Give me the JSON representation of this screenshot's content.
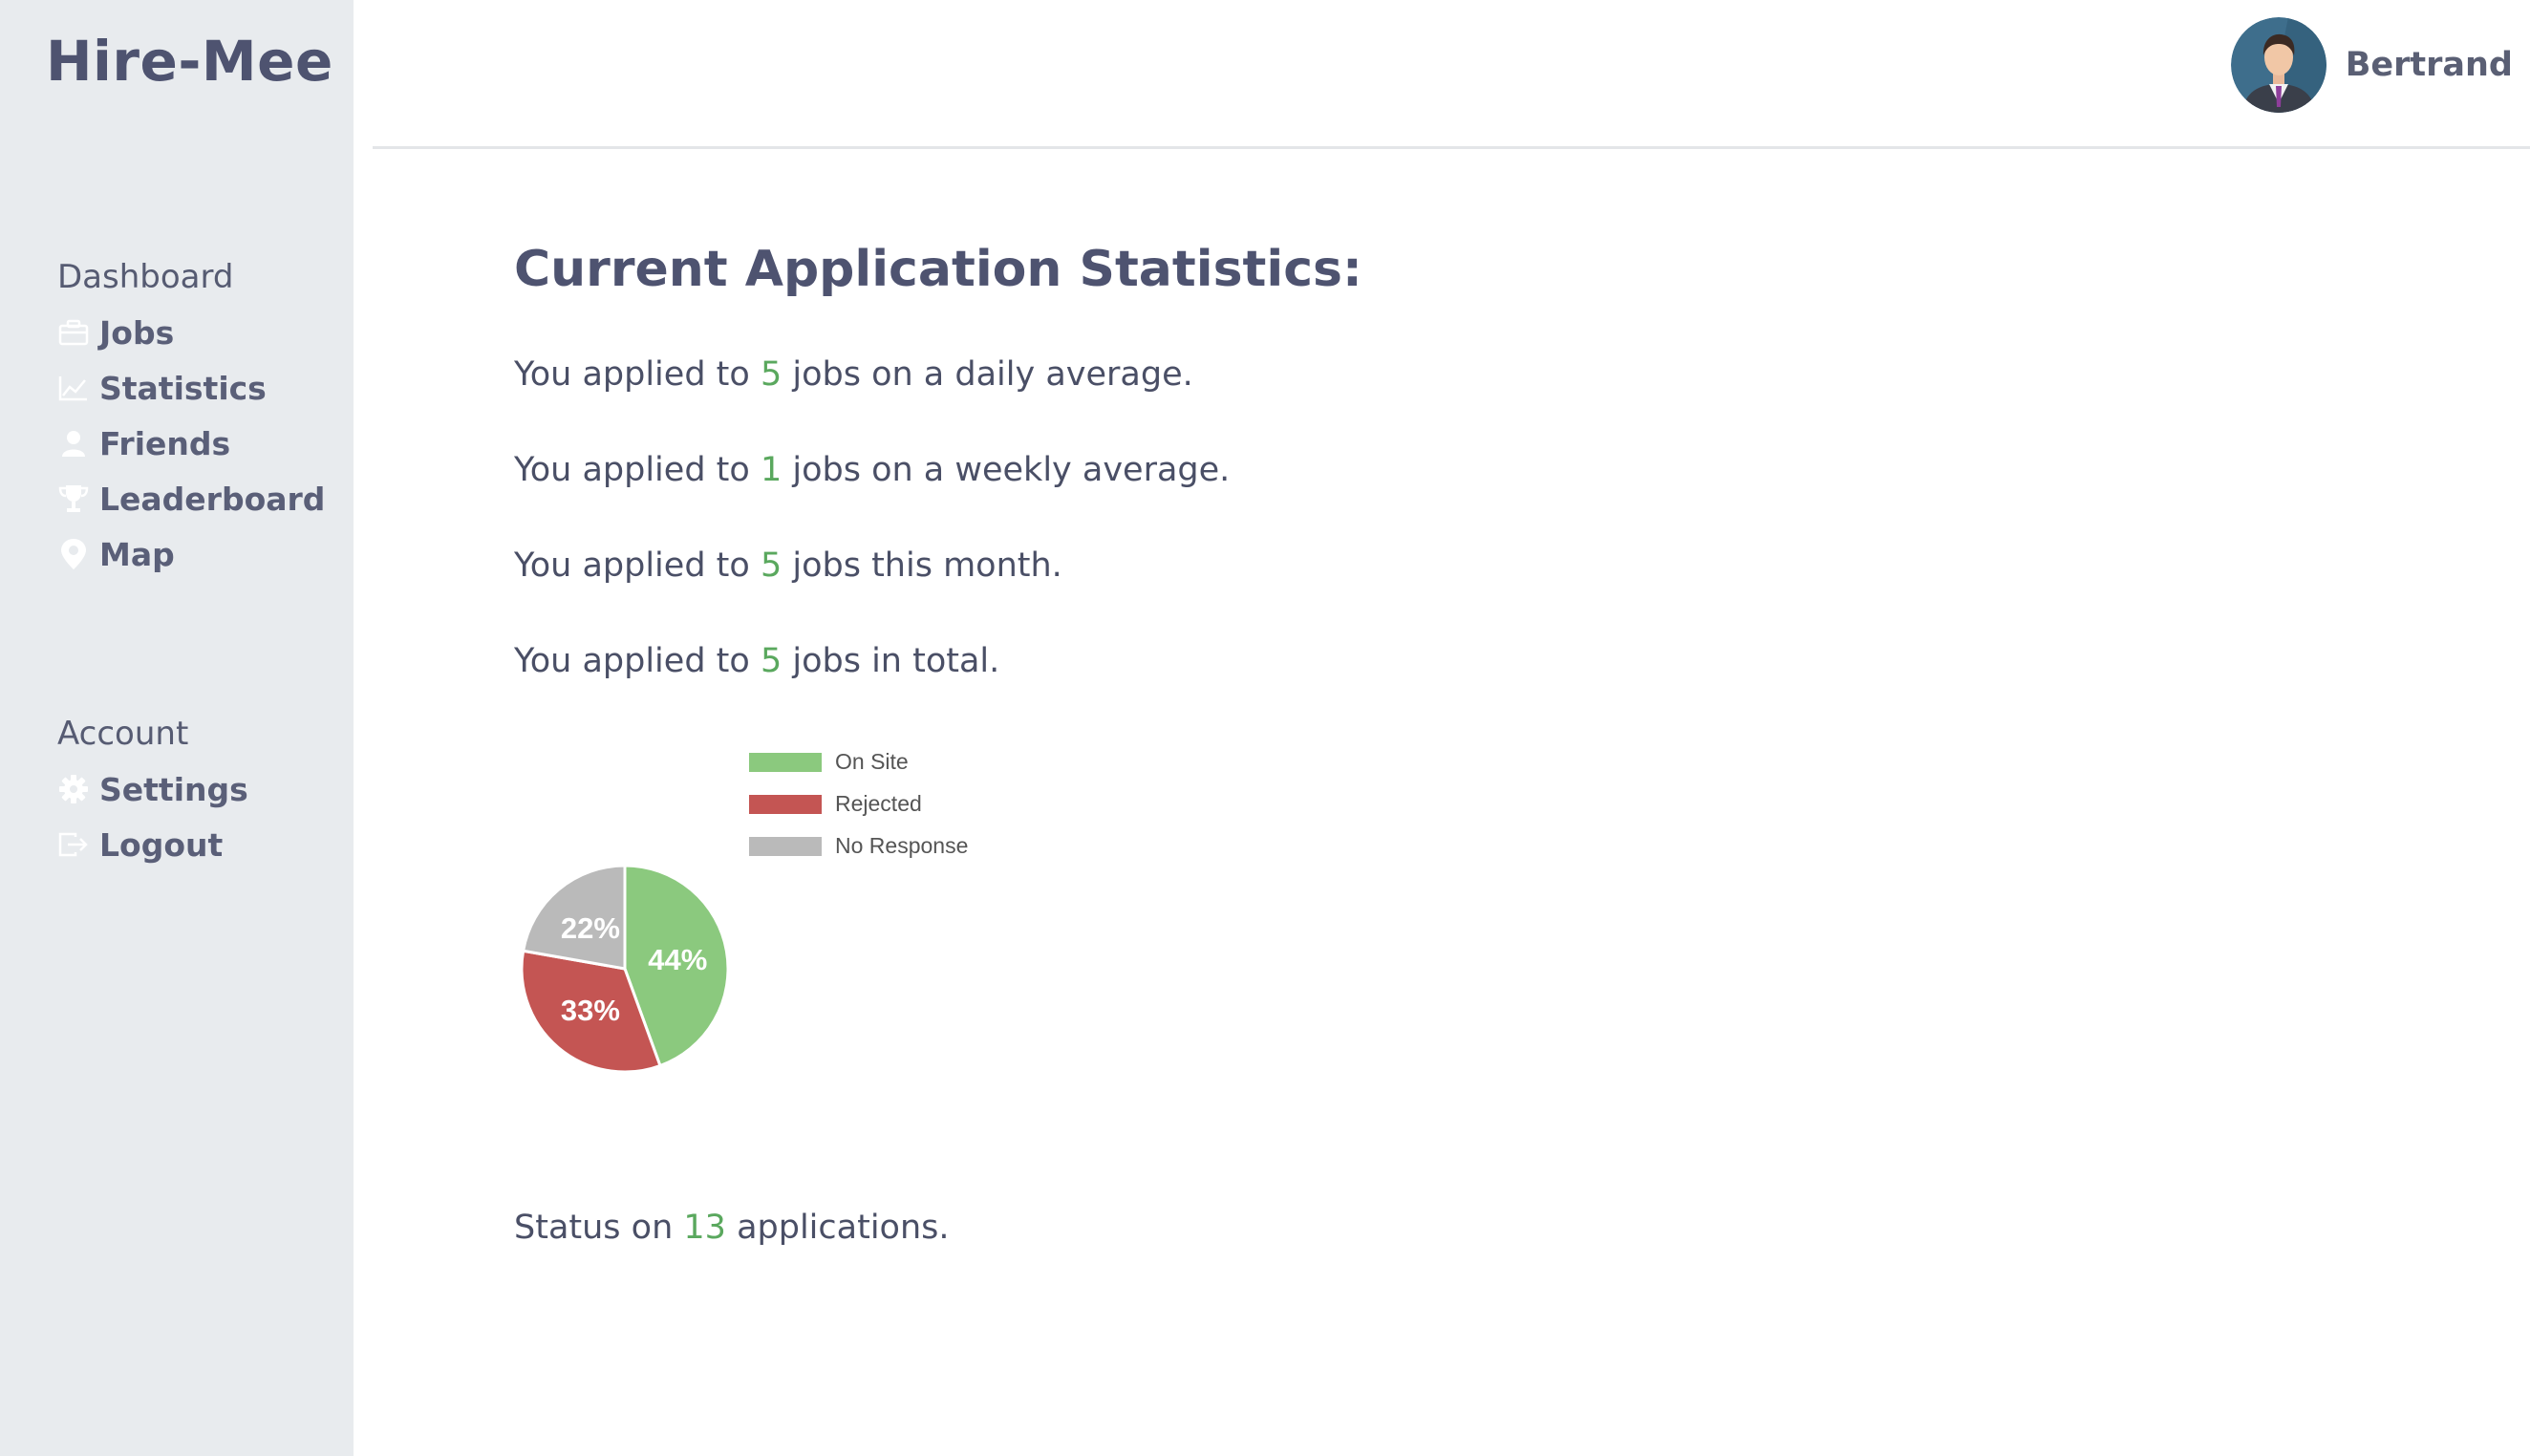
{
  "app": {
    "logo": "Hire-Mee"
  },
  "sidebar": {
    "sections": [
      {
        "title": "Dashboard",
        "items": [
          {
            "label": "Jobs",
            "icon": "briefcase-icon"
          },
          {
            "label": "Statistics",
            "icon": "chart-line-icon"
          },
          {
            "label": "Friends",
            "icon": "user-icon"
          },
          {
            "label": "Leaderboard",
            "icon": "trophy-icon"
          },
          {
            "label": "Map",
            "icon": "map-pin-icon"
          }
        ]
      },
      {
        "title": "Account",
        "items": [
          {
            "label": "Settings",
            "icon": "gear-icon"
          },
          {
            "label": "Logout",
            "icon": "logout-icon"
          }
        ]
      }
    ]
  },
  "user": {
    "name": "Bertrand"
  },
  "main": {
    "title": "Current Application Statistics:",
    "stats": [
      {
        "prefix": "You applied to",
        "value": "5",
        "suffix": "jobs on a daily average."
      },
      {
        "prefix": "You applied to",
        "value": "1",
        "suffix": "jobs on a weekly average."
      },
      {
        "prefix": "You applied to",
        "value": "5",
        "suffix": "jobs this month."
      },
      {
        "prefix": "You applied to",
        "value": "5",
        "suffix": "jobs in total."
      }
    ],
    "status": {
      "prefix": "Status on",
      "value": "13",
      "suffix": "applications."
    }
  },
  "colors": {
    "accent_number": "#5aa85e",
    "on_site": "#8bc97e",
    "rejected": "#c45553",
    "no_response": "#bababa",
    "sidebar_bg": "#e8ebee"
  },
  "chart_data": {
    "type": "pie",
    "categories": [
      "On Site",
      "Rejected",
      "No Response"
    ],
    "values": [
      44,
      33,
      22
    ],
    "labels": [
      "44%",
      "33%",
      "22%"
    ],
    "colors": [
      "#8bc97e",
      "#c45553",
      "#bababa"
    ],
    "legend_position": "top"
  }
}
